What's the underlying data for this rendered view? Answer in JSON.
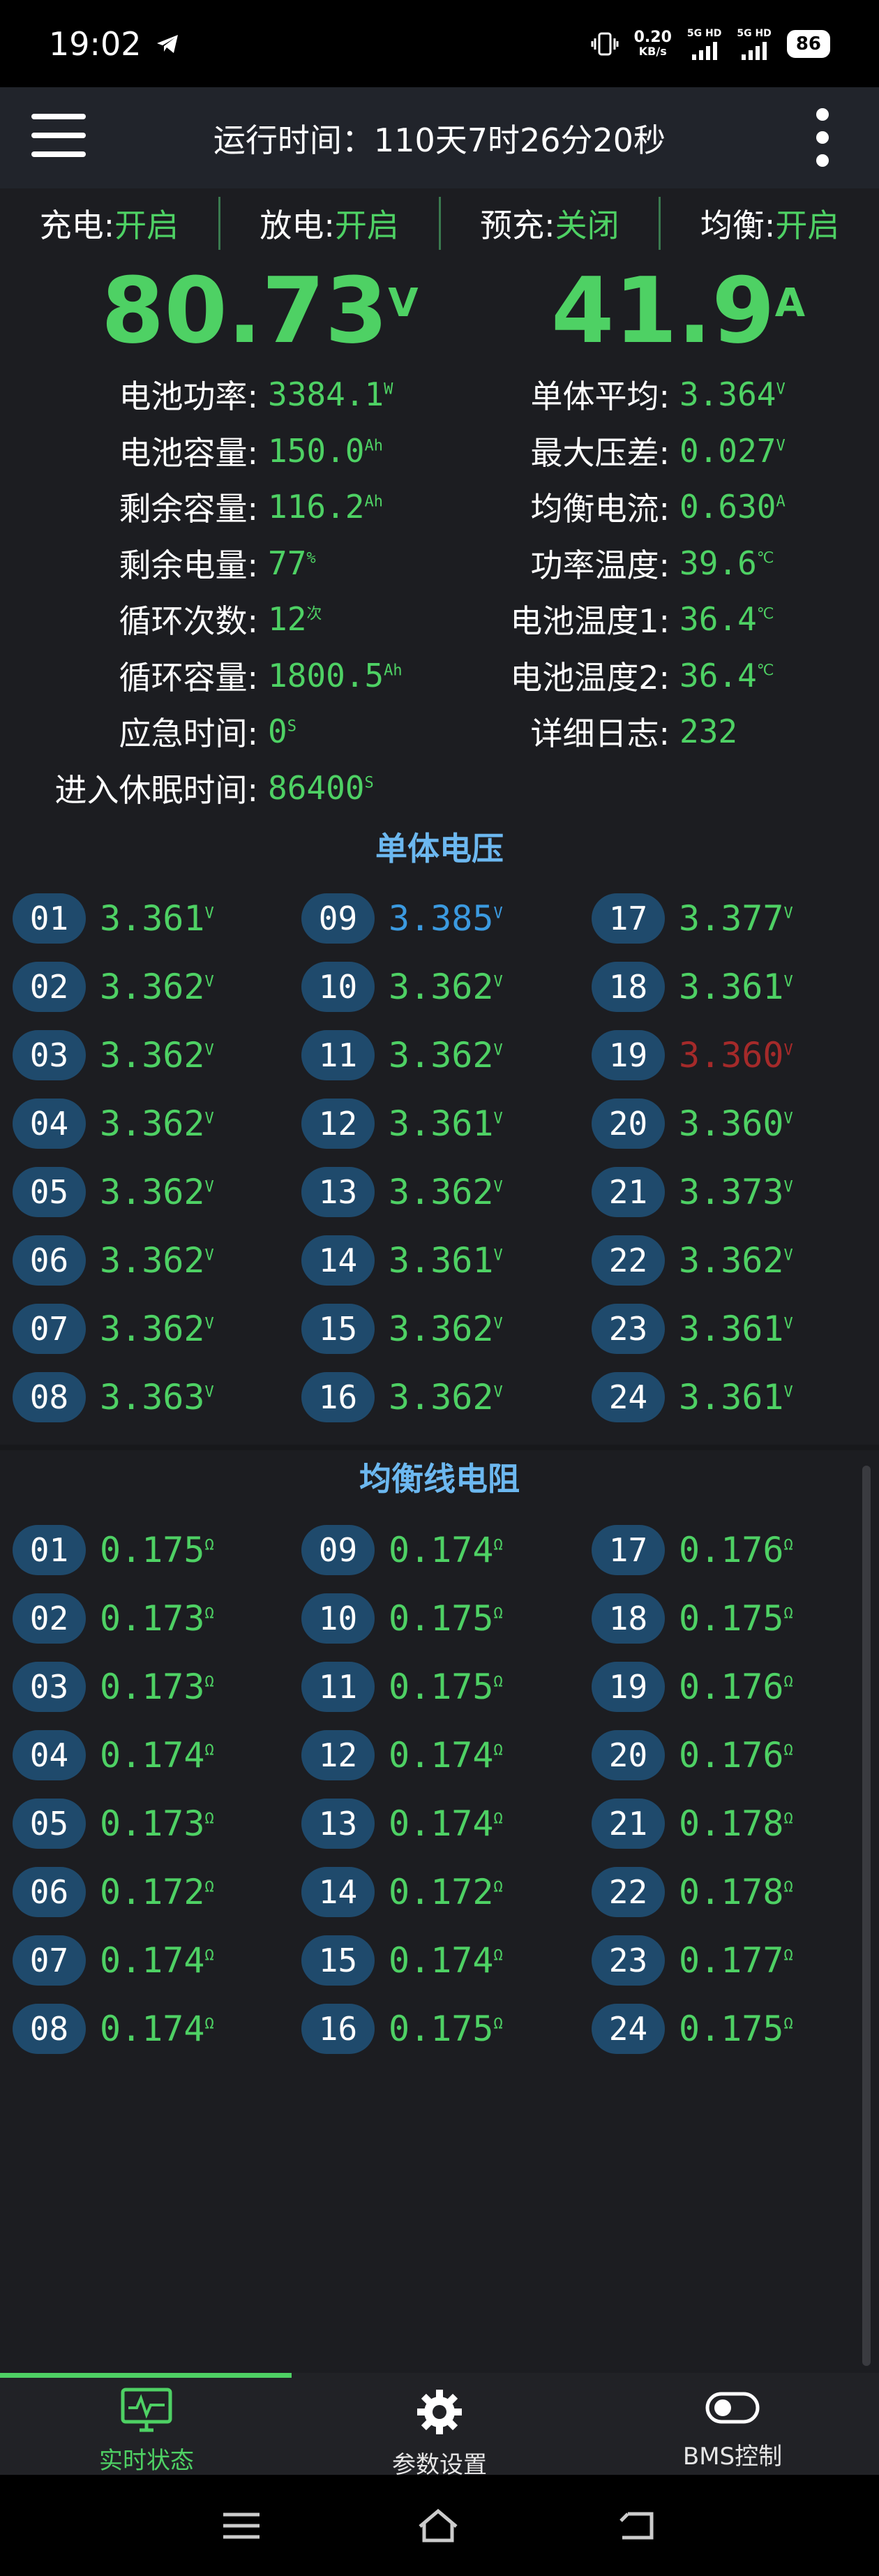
{
  "status_bar": {
    "time": "19:02",
    "net_speed_value": "0.20",
    "net_speed_unit": "KB/s",
    "sim1": "5G HD",
    "sim2": "5G HD",
    "battery": "86"
  },
  "appbar": {
    "title": "运行时间：110天7时26分20秒",
    "menu_icon": "hamburger-icon",
    "more_icon": "more-vertical-icon"
  },
  "status_row": [
    {
      "label": "充电: ",
      "value": "开启"
    },
    {
      "label": "放电: ",
      "value": "开启"
    },
    {
      "label": "预充: ",
      "value": "关闭"
    },
    {
      "label": "均衡: ",
      "value": "开启"
    }
  ],
  "voltage": {
    "value": "80.73",
    "unit": "V"
  },
  "current": {
    "value": "41.9",
    "unit": "A"
  },
  "left_metrics": [
    {
      "label": "电池功率:",
      "value": "3384.1",
      "unit": "W"
    },
    {
      "label": "电池容量:",
      "value": "150.0",
      "unit": "Ah"
    },
    {
      "label": "剩余容量:",
      "value": "116.2",
      "unit": "Ah"
    },
    {
      "label": "剩余电量:",
      "value": "77",
      "unit": "%"
    },
    {
      "label": "循环次数:",
      "value": "12",
      "unit": "次"
    },
    {
      "label": "循环容量:",
      "value": "1800.5",
      "unit": "Ah"
    },
    {
      "label": "应急时间:",
      "value": "0",
      "unit": "S"
    },
    {
      "label": "进入休眠时间:",
      "value": "86400",
      "unit": "S"
    }
  ],
  "right_metrics": [
    {
      "label": "单体平均:",
      "value": "3.364",
      "unit": "V"
    },
    {
      "label": "最大压差:",
      "value": "0.027",
      "unit": "V"
    },
    {
      "label": "均衡电流:",
      "value": "0.630",
      "unit": "A"
    },
    {
      "label": "功率温度:",
      "value": "39.6",
      "unit": "℃"
    },
    {
      "label": "电池温度1:",
      "value": "36.4",
      "unit": "℃"
    },
    {
      "label": "电池温度2:",
      "value": "36.4",
      "unit": "℃"
    },
    {
      "label": "详细日志:",
      "value": "232",
      "unit": ""
    }
  ],
  "cell_voltage": {
    "title": "单体电压",
    "unit": "V",
    "cells": [
      {
        "id": "01",
        "value": "3.361",
        "state": "normal"
      },
      {
        "id": "02",
        "value": "3.362",
        "state": "normal"
      },
      {
        "id": "03",
        "value": "3.362",
        "state": "normal"
      },
      {
        "id": "04",
        "value": "3.362",
        "state": "normal"
      },
      {
        "id": "05",
        "value": "3.362",
        "state": "normal"
      },
      {
        "id": "06",
        "value": "3.362",
        "state": "normal"
      },
      {
        "id": "07",
        "value": "3.362",
        "state": "normal"
      },
      {
        "id": "08",
        "value": "3.363",
        "state": "normal"
      },
      {
        "id": "09",
        "value": "3.385",
        "state": "max"
      },
      {
        "id": "10",
        "value": "3.362",
        "state": "normal"
      },
      {
        "id": "11",
        "value": "3.362",
        "state": "normal"
      },
      {
        "id": "12",
        "value": "3.361",
        "state": "normal"
      },
      {
        "id": "13",
        "value": "3.362",
        "state": "normal"
      },
      {
        "id": "14",
        "value": "3.361",
        "state": "normal"
      },
      {
        "id": "15",
        "value": "3.362",
        "state": "normal"
      },
      {
        "id": "16",
        "value": "3.362",
        "state": "normal"
      },
      {
        "id": "17",
        "value": "3.377",
        "state": "normal"
      },
      {
        "id": "18",
        "value": "3.361",
        "state": "normal"
      },
      {
        "id": "19",
        "value": "3.360",
        "state": "min"
      },
      {
        "id": "20",
        "value": "3.360",
        "state": "normal"
      },
      {
        "id": "21",
        "value": "3.373",
        "state": "normal"
      },
      {
        "id": "22",
        "value": "3.362",
        "state": "normal"
      },
      {
        "id": "23",
        "value": "3.361",
        "state": "normal"
      },
      {
        "id": "24",
        "value": "3.361",
        "state": "normal"
      }
    ]
  },
  "balance_resistance": {
    "title": "均衡线电阻",
    "unit": "Ω",
    "cells": [
      {
        "id": "01",
        "value": "0.175"
      },
      {
        "id": "02",
        "value": "0.173"
      },
      {
        "id": "03",
        "value": "0.173"
      },
      {
        "id": "04",
        "value": "0.174"
      },
      {
        "id": "05",
        "value": "0.173"
      },
      {
        "id": "06",
        "value": "0.172"
      },
      {
        "id": "07",
        "value": "0.174"
      },
      {
        "id": "08",
        "value": "0.174"
      },
      {
        "id": "09",
        "value": "0.174"
      },
      {
        "id": "10",
        "value": "0.175"
      },
      {
        "id": "11",
        "value": "0.175"
      },
      {
        "id": "12",
        "value": "0.174"
      },
      {
        "id": "13",
        "value": "0.174"
      },
      {
        "id": "14",
        "value": "0.172"
      },
      {
        "id": "15",
        "value": "0.174"
      },
      {
        "id": "16",
        "value": "0.175"
      },
      {
        "id": "17",
        "value": "0.176"
      },
      {
        "id": "18",
        "value": "0.175"
      },
      {
        "id": "19",
        "value": "0.176"
      },
      {
        "id": "20",
        "value": "0.176"
      },
      {
        "id": "21",
        "value": "0.178"
      },
      {
        "id": "22",
        "value": "0.178"
      },
      {
        "id": "23",
        "value": "0.177"
      },
      {
        "id": "24",
        "value": "0.175"
      }
    ]
  },
  "bottom_nav": [
    {
      "label": "实时状态",
      "icon": "monitor-icon",
      "active": true
    },
    {
      "label": "参数设置",
      "icon": "gear-icon",
      "active": false
    },
    {
      "label": "BMS控制",
      "icon": "toggle-icon",
      "active": false
    }
  ],
  "colors": {
    "accent": "#4ed164",
    "section_title": "#6cb8f0",
    "max_cell": "#3b9ae0",
    "min_cell": "#a52a2a",
    "pill": "#1f4a6c"
  }
}
